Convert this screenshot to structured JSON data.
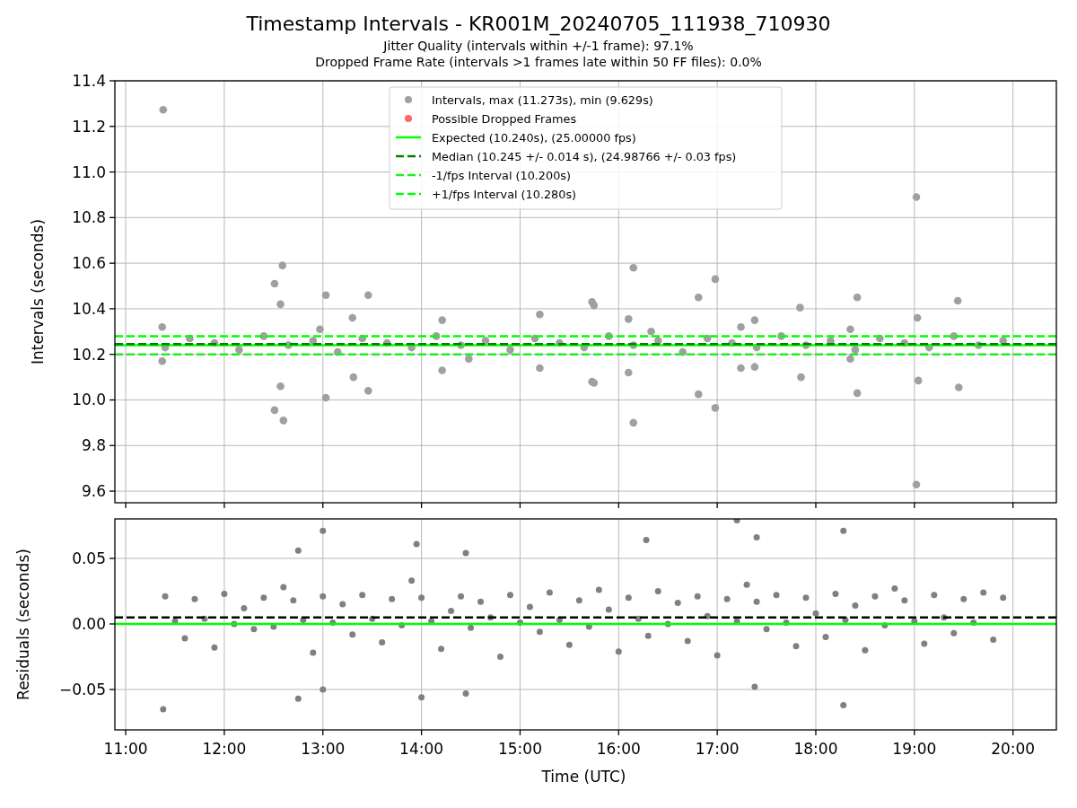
{
  "title": "Timestamp Intervals - KR001M_20240705_111938_710930",
  "subtitle_lines": [
    "Jitter Quality (intervals within +/-1 frame): 97.1%",
    "Dropped Frame Rate (intervals >1 frames late within 50 FF files): 0.0%"
  ],
  "charts": [
    {
      "chart_data": {
        "type": "scatter",
        "ylabel": "Intervals (seconds)",
        "grid": true,
        "legend": "upper center",
        "xlim": [
          10.89,
          20.44
        ],
        "ylim": [
          9.549,
          11.4
        ],
        "yticks": [
          {
            "value": 9.6,
            "label": "9.6"
          },
          {
            "value": 9.8,
            "label": "9.8"
          },
          {
            "value": 10.0,
            "label": "10.0"
          },
          {
            "value": 10.2,
            "label": "10.2"
          },
          {
            "value": 10.4,
            "label": "10.4"
          },
          {
            "value": 10.6,
            "label": "10.6"
          },
          {
            "value": 10.8,
            "label": "10.8"
          },
          {
            "value": 11.0,
            "label": "11.0"
          },
          {
            "value": 11.2,
            "label": "11.2"
          },
          {
            "value": 11.4,
            "label": "11.4"
          }
        ],
        "x": [
          11.4,
          11.65,
          11.9,
          12.15,
          12.4,
          12.65,
          12.9,
          13.15,
          13.4,
          13.65,
          13.9,
          14.15,
          14.4,
          14.65,
          14.9,
          15.15,
          15.4,
          15.65,
          15.9,
          16.15,
          16.4,
          16.65,
          16.9,
          17.15,
          17.4,
          17.65,
          17.9,
          18.15,
          18.4,
          18.65,
          18.9,
          19.15,
          19.4,
          19.65,
          19.9,
          11.38,
          11.37,
          11.37,
          12.51,
          12.57,
          12.59,
          12.57,
          12.51,
          12.6,
          13.03,
          13.03,
          12.97,
          13.3,
          13.31,
          13.46,
          13.46,
          14.21,
          14.21,
          14.48,
          15.2,
          15.2,
          15.73,
          15.75,
          15.73,
          15.75,
          16.1,
          16.1,
          16.15,
          16.15,
          16.33,
          16.81,
          16.81,
          16.98,
          16.98,
          17.24,
          17.24,
          17.38,
          17.38,
          17.84,
          17.85,
          18.35,
          18.35,
          18.42,
          18.42,
          19.02,
          19.02,
          19.03,
          19.04,
          19.44,
          19.45
        ],
        "series": [
          {
            "name": "Intervals, max (11.273s), min (9.629s)",
            "color": "#a0a0a0",
            "values": [
              10.23,
              10.27,
              10.25,
              10.22,
              10.28,
              10.24,
              10.26,
              10.21,
              10.27,
              10.25,
              10.23,
              10.28,
              10.24,
              10.26,
              10.22,
              10.27,
              10.25,
              10.23,
              10.28,
              10.24,
              10.26,
              10.21,
              10.27,
              10.25,
              10.23,
              10.28,
              10.24,
              10.26,
              10.22,
              10.27,
              10.25,
              10.23,
              10.28,
              10.24,
              10.26,
              11.273,
              10.32,
              10.17,
              10.51,
              10.42,
              10.59,
              10.06,
              9.955,
              9.91,
              10.46,
              10.01,
              10.31,
              10.36,
              10.1,
              10.46,
              10.04,
              10.35,
              10.13,
              10.18,
              10.375,
              10.14,
              10.43,
              10.415,
              10.08,
              10.075,
              10.355,
              10.12,
              10.58,
              9.9,
              10.3,
              10.45,
              10.025,
              10.53,
              9.965,
              10.32,
              10.14,
              10.35,
              10.145,
              10.405,
              10.1,
              10.31,
              10.18,
              10.45,
              10.03,
              10.89,
              9.629,
              10.36,
              10.085,
              10.435,
              10.055
            ]
          },
          {
            "name": "Possible Dropped Frames",
            "color": "#ff6666",
            "values": [
              null,
              null,
              null,
              null,
              null,
              null,
              null,
              null,
              null,
              null,
              null,
              null,
              null,
              null,
              null,
              null,
              null,
              null,
              null,
              null,
              null,
              null,
              null,
              null,
              null,
              null,
              null,
              null,
              null,
              null,
              null,
              null,
              null,
              null,
              null,
              null,
              null,
              null,
              null,
              null,
              null,
              null,
              null,
              null,
              null,
              null,
              null,
              null,
              null,
              null,
              null,
              null,
              null,
              null,
              null,
              null,
              null,
              null,
              null,
              null,
              null,
              null,
              null,
              null,
              null,
              null,
              null,
              null,
              null,
              null,
              null,
              null,
              null,
              null,
              null,
              null,
              null,
              null,
              null,
              null,
              null,
              null,
              null,
              null,
              null
            ]
          }
        ],
        "ref_lines": [
          {
            "axis": "y",
            "value": 10.24,
            "label": "Expected (10.240s), (25.00000 fps)",
            "color": "#00ff00"
          },
          {
            "axis": "y",
            "value": 10.245,
            "label": "Median (10.245 +/- 0.014 s), (24.98766 +/- 0.03 fps)",
            "color": "#008000"
          },
          {
            "axis": "y",
            "value": 10.2,
            "label": "-1/fps Interval (10.200s)",
            "color": "#22ee22"
          },
          {
            "axis": "y",
            "value": 10.28,
            "label": "+1/fps Interval (10.280s)",
            "color": "#00ff00"
          }
        ]
      }
    },
    {
      "chart_data": {
        "type": "scatter",
        "xlabel": "Time (UTC)",
        "ylabel": "Residuals (seconds)",
        "grid": true,
        "xlim": [
          10.89,
          20.44
        ],
        "ylim": [
          -0.0808,
          0.0801
        ],
        "xticks": [
          {
            "value": 11,
            "label": "11:00"
          },
          {
            "value": 12,
            "label": "12:00"
          },
          {
            "value": 13,
            "label": "13:00"
          },
          {
            "value": 14,
            "label": "14:00"
          },
          {
            "value": 15,
            "label": "15:00"
          },
          {
            "value": 16,
            "label": "16:00"
          },
          {
            "value": 17,
            "label": "17:00"
          },
          {
            "value": 18,
            "label": "18:00"
          },
          {
            "value": 19,
            "label": "19:00"
          },
          {
            "value": 20,
            "label": "20:00"
          }
        ],
        "yticks": [
          {
            "value": -0.05,
            "label": "−0.05"
          },
          {
            "value": 0,
            "label": "0.00"
          },
          {
            "value": 0.05,
            "label": "0.05"
          }
        ],
        "x": [
          11.4,
          11.5,
          11.6,
          11.7,
          11.8,
          11.9,
          12.0,
          12.1,
          12.2,
          12.3,
          12.4,
          12.5,
          12.6,
          12.7,
          12.8,
          12.9,
          13.0,
          13.1,
          13.2,
          13.3,
          13.4,
          13.5,
          13.6,
          13.7,
          13.8,
          13.9,
          14.0,
          14.1,
          14.2,
          14.3,
          14.4,
          14.5,
          14.6,
          14.7,
          14.8,
          14.9,
          15.0,
          15.1,
          15.2,
          15.3,
          15.4,
          15.5,
          15.6,
          15.7,
          15.8,
          15.9,
          16.0,
          16.1,
          16.2,
          16.3,
          16.4,
          16.5,
          16.6,
          16.7,
          16.8,
          16.9,
          17.0,
          17.1,
          17.2,
          17.3,
          17.4,
          17.5,
          17.6,
          17.7,
          17.8,
          17.9,
          18.0,
          18.1,
          18.2,
          18.3,
          18.4,
          18.5,
          18.6,
          18.7,
          18.8,
          18.9,
          19.0,
          19.1,
          19.2,
          19.3,
          19.4,
          19.5,
          19.6,
          19.7,
          19.8,
          19.9,
          11.38,
          12.75,
          12.75,
          13.0,
          13.0,
          13.95,
          14.0,
          14.45,
          14.45,
          16.28,
          17.2,
          17.38,
          17.4,
          18.28,
          18.28
        ],
        "series": [
          {
            "color": "#808080",
            "values": [
              0.021,
              0.002,
              -0.011,
              0.019,
              0.004,
              -0.018,
              0.023,
              0.0,
              0.012,
              -0.004,
              0.02,
              -0.002,
              0.028,
              0.018,
              0.003,
              -0.022,
              0.021,
              0.001,
              0.015,
              -0.008,
              0.022,
              0.004,
              -0.014,
              0.019,
              -0.001,
              0.033,
              0.02,
              0.002,
              -0.019,
              0.01,
              0.021,
              -0.003,
              0.017,
              0.005,
              -0.025,
              0.022,
              0.001,
              0.013,
              -0.006,
              0.024,
              0.003,
              -0.016,
              0.018,
              -0.002,
              0.026,
              0.011,
              -0.021,
              0.02,
              0.004,
              -0.009,
              0.025,
              0.0,
              0.016,
              -0.013,
              0.021,
              0.006,
              -0.024,
              0.019,
              0.002,
              0.03,
              0.017,
              -0.004,
              0.022,
              0.001,
              -0.017,
              0.02,
              0.008,
              -0.01,
              0.023,
              0.003,
              0.014,
              -0.02,
              0.021,
              -0.001,
              0.027,
              0.018,
              0.002,
              -0.015,
              0.022,
              0.005,
              -0.007,
              0.019,
              0.001,
              0.024,
              -0.012,
              0.02,
              -0.065,
              0.056,
              -0.057,
              0.071,
              -0.05,
              0.061,
              -0.056,
              0.054,
              -0.053,
              0.064,
              0.079,
              -0.048,
              0.066,
              0.071,
              -0.062
            ]
          }
        ],
        "ref_lines": [
          {
            "axis": "y",
            "value": 0.0,
            "color": "#00ff00"
          },
          {
            "axis": "y",
            "value": 0.005,
            "color": "#000000"
          }
        ]
      }
    }
  ]
}
